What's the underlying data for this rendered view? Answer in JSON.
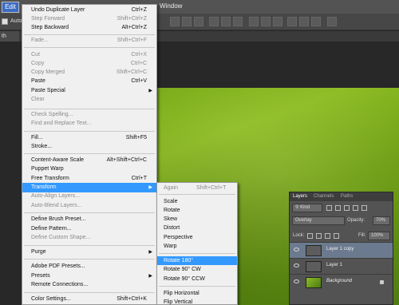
{
  "menubar": {
    "edit": "Edit",
    "window": "Window"
  },
  "options": {
    "auto_select": "Auto-"
  },
  "doc_tab": {
    "label": "th Tutori"
  },
  "edit_menu": {
    "items": [
      {
        "label": "Undo Duplicate Layer",
        "shortcut": "Ctrl+Z",
        "enabled": true
      },
      {
        "label": "Step Forward",
        "shortcut": "Shift+Ctrl+Z",
        "enabled": false
      },
      {
        "label": "Step Backward",
        "shortcut": "Alt+Ctrl+Z",
        "enabled": true
      },
      {
        "label": "Fade...",
        "shortcut": "Shift+Ctrl+F",
        "enabled": false
      },
      {
        "label": "Cut",
        "shortcut": "Ctrl+X",
        "enabled": false
      },
      {
        "label": "Copy",
        "shortcut": "Ctrl+C",
        "enabled": false
      },
      {
        "label": "Copy Merged",
        "shortcut": "Shift+Ctrl+C",
        "enabled": false
      },
      {
        "label": "Paste",
        "shortcut": "Ctrl+V",
        "enabled": true
      },
      {
        "label": "Paste Special",
        "shortcut": "",
        "enabled": true,
        "submenu": true
      },
      {
        "label": "Clear",
        "shortcut": "",
        "enabled": false
      },
      {
        "label": "Check Spelling...",
        "shortcut": "",
        "enabled": false
      },
      {
        "label": "Find and Replace Text...",
        "shortcut": "",
        "enabled": false
      },
      {
        "label": "Fill...",
        "shortcut": "Shift+F5",
        "enabled": true
      },
      {
        "label": "Stroke...",
        "shortcut": "",
        "enabled": true
      },
      {
        "label": "Content-Aware Scale",
        "shortcut": "Alt+Shift+Ctrl+C",
        "enabled": true
      },
      {
        "label": "Puppet Warp",
        "shortcut": "",
        "enabled": true
      },
      {
        "label": "Free Transform",
        "shortcut": "Ctrl+T",
        "enabled": true
      },
      {
        "label": "Transform",
        "shortcut": "",
        "enabled": true,
        "submenu": true,
        "highlighted": true
      },
      {
        "label": "Auto-Align Layers...",
        "shortcut": "",
        "enabled": false
      },
      {
        "label": "Auto-Blend Layers...",
        "shortcut": "",
        "enabled": false
      },
      {
        "label": "Define Brush Preset...",
        "shortcut": "",
        "enabled": true
      },
      {
        "label": "Define Pattern...",
        "shortcut": "",
        "enabled": true
      },
      {
        "label": "Define Custom Shape...",
        "shortcut": "",
        "enabled": false
      },
      {
        "label": "Purge",
        "shortcut": "",
        "enabled": true,
        "submenu": true
      },
      {
        "label": "Adobe PDF Presets...",
        "shortcut": "",
        "enabled": true
      },
      {
        "label": "Presets",
        "shortcut": "",
        "enabled": true,
        "submenu": true
      },
      {
        "label": "Remote Connections...",
        "shortcut": "",
        "enabled": true
      },
      {
        "label": "Color Settings...",
        "shortcut": "Shift+Ctrl+K",
        "enabled": true
      }
    ]
  },
  "transform_menu": {
    "items": [
      {
        "label": "Again",
        "shortcut": "Shift+Ctrl+T",
        "enabled": false
      },
      {
        "label": "Scale",
        "shortcut": "",
        "enabled": true
      },
      {
        "label": "Rotate",
        "shortcut": "",
        "enabled": true
      },
      {
        "label": "Skew",
        "shortcut": "",
        "enabled": true
      },
      {
        "label": "Distort",
        "shortcut": "",
        "enabled": true
      },
      {
        "label": "Perspective",
        "shortcut": "",
        "enabled": true
      },
      {
        "label": "Warp",
        "shortcut": "",
        "enabled": true
      },
      {
        "label": "Rotate 180°",
        "shortcut": "",
        "enabled": true,
        "highlighted": true
      },
      {
        "label": "Rotate 90° CW",
        "shortcut": "",
        "enabled": true
      },
      {
        "label": "Rotate 90° CCW",
        "shortcut": "",
        "enabled": true
      },
      {
        "label": "Flip Horizontal",
        "shortcut": "",
        "enabled": true
      },
      {
        "label": "Flip Vertical",
        "shortcut": "",
        "enabled": true
      }
    ]
  },
  "layers_panel": {
    "tabs": [
      "Layers",
      "Channels",
      "Paths"
    ],
    "kind_label": "Kind",
    "blend_mode": "Overlay",
    "opacity_label": "Opacity:",
    "opacity_value": "70%",
    "lock_label": "Lock:",
    "fill_label": "Fill:",
    "fill_value": "100%",
    "layers": [
      {
        "name": "Layer 1 copy",
        "selected": true
      },
      {
        "name": "Layer 1",
        "selected": false
      },
      {
        "name": "Background",
        "selected": false
      }
    ]
  },
  "colors": {
    "highlight": "#3399ff",
    "menu_bg": "#f0f0f0",
    "canvas_green": "#7fb01f"
  }
}
